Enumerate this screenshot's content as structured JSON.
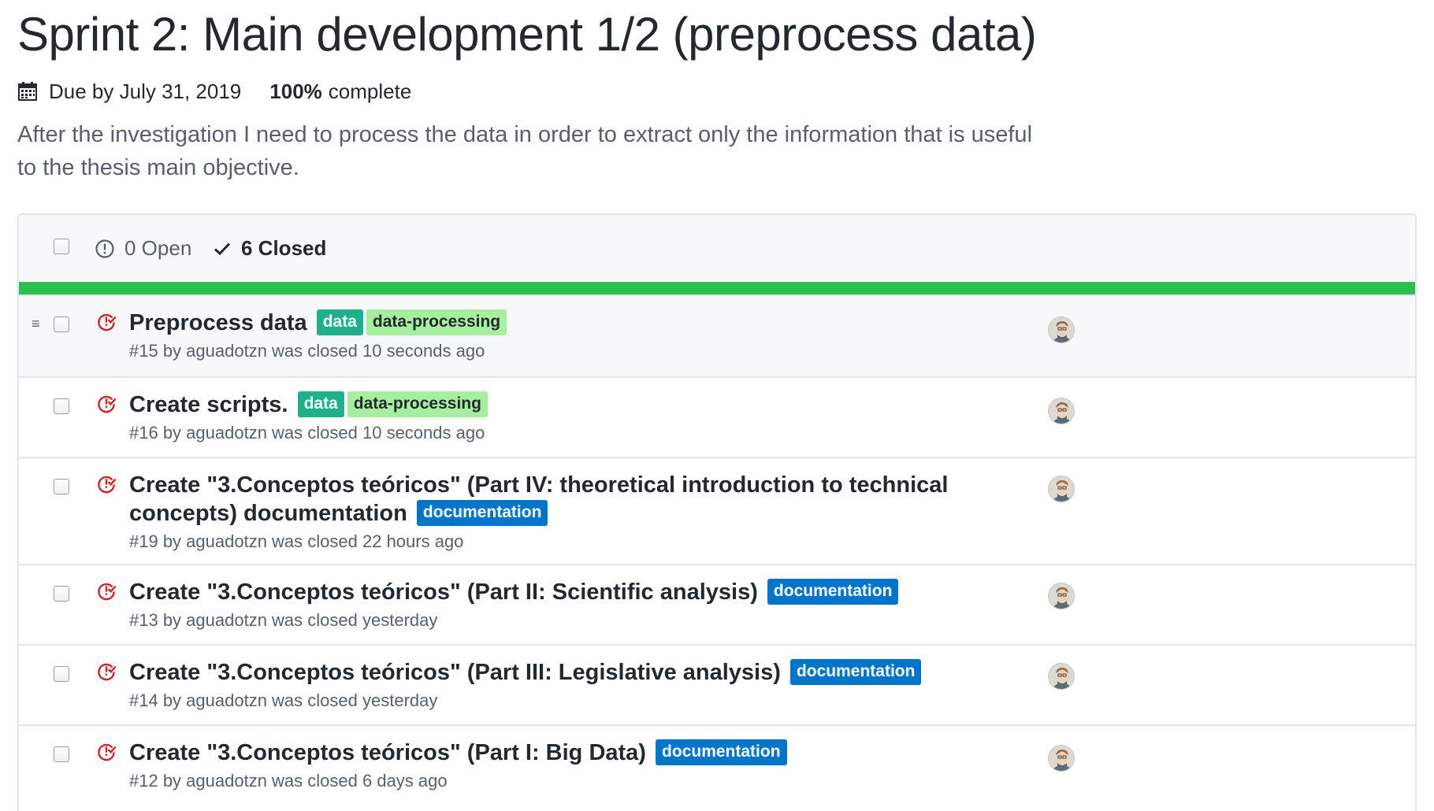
{
  "milestone": {
    "title": "Sprint 2: Main development 1/2 (preprocess data)",
    "due": "Due by July 31, 2019",
    "percent": "100%",
    "percent_suffix": "complete",
    "description": "After the investigation I need to process the data in order to extract only the information that is useful to the thesis main objective.",
    "progress_fraction": 1.0
  },
  "filters": {
    "open_label": "0 Open",
    "closed_label": "6 Closed"
  },
  "colors": {
    "progress": "#2cbe4e",
    "closed_icon": "#cb2431",
    "label_data": "#1faf89",
    "label_data_processing": "#a8eea0",
    "label_documentation": "#0075ca"
  },
  "issues": [
    {
      "title": "Preprocess data",
      "labels": [
        "data",
        "data-processing"
      ],
      "meta": "#15 by aguadotzn was closed 10 seconds ago"
    },
    {
      "title": "Create scripts.",
      "labels": [
        "data",
        "data-processing"
      ],
      "meta": "#16 by aguadotzn was closed 10 seconds ago"
    },
    {
      "title": "Create \"3.Conceptos teóricos\" (Part IV: theoretical introduction to technical concepts) documentation",
      "labels": [
        "documentation"
      ],
      "meta": "#19 by aguadotzn was closed 22 hours ago"
    },
    {
      "title": "Create \"3.Conceptos teóricos\" (Part II: Scientific analysis)",
      "labels": [
        "documentation"
      ],
      "meta": "#13 by aguadotzn was closed yesterday"
    },
    {
      "title": "Create \"3.Conceptos teóricos\" (Part III: Legislative analysis)",
      "labels": [
        "documentation"
      ],
      "meta": "#14 by aguadotzn was closed yesterday"
    },
    {
      "title": "Create \"3.Conceptos teóricos\" (Part I: Big Data)",
      "labels": [
        "documentation"
      ],
      "meta": "#12 by aguadotzn was closed 6 days ago"
    }
  ]
}
